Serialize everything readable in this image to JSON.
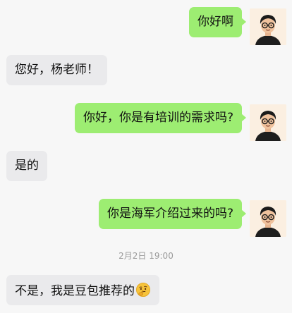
{
  "messages": [
    {
      "side": "out",
      "text": "你好啊"
    },
    {
      "side": "in",
      "text": "您好，杨老师！"
    },
    {
      "side": "out",
      "text": "你好，你是有培训的需求吗?"
    },
    {
      "side": "in",
      "text": "是的"
    },
    {
      "side": "out",
      "text": "你是海军介绍过来的吗?"
    },
    {
      "side": "in",
      "text": "不是，我是豆包推荐的",
      "emoji": "thinking-face-emoji"
    }
  ],
  "timestamp": "2月2日 19:00",
  "colors": {
    "outgoing_bubble": "#9ded72",
    "incoming_bubble": "#eaeaec",
    "background": "#f7f7f7",
    "avatar_bg": "#fbefe1"
  },
  "icons": {
    "avatar": "cartoon-boy-glasses-avatar",
    "emoji": "thinking-face-emoji"
  }
}
